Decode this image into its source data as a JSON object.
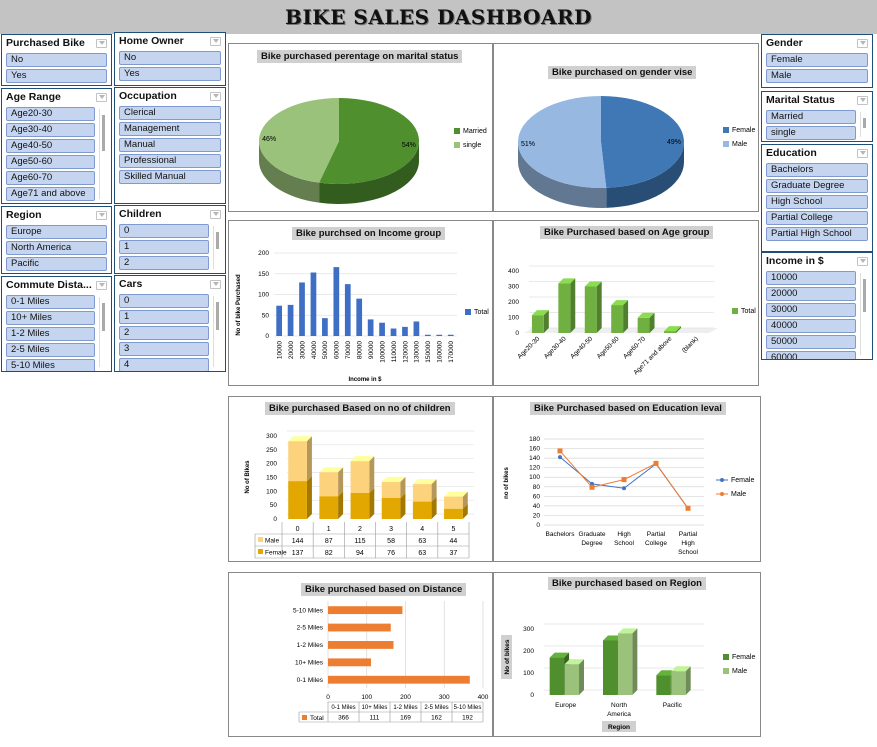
{
  "title": "BIKE SALES DASHBOARD",
  "slicers": {
    "purchased_bike": {
      "label": "Purchased Bike",
      "items": [
        "No",
        "Yes"
      ]
    },
    "home_owner": {
      "label": "Home Owner",
      "items": [
        "No",
        "Yes"
      ]
    },
    "age_range": {
      "label": "Age Range",
      "items": [
        "Age20-30",
        "Age30-40",
        "Age40-50",
        "Age50-60",
        "Age60-70",
        "Age71 and above"
      ]
    },
    "occupation": {
      "label": "Occupation",
      "items": [
        "Clerical",
        "Management",
        "Manual",
        "Professional",
        "Skilled Manual"
      ]
    },
    "region": {
      "label": "Region",
      "items": [
        "Europe",
        "North America",
        "Pacific"
      ]
    },
    "children": {
      "label": "Children",
      "items": [
        "0",
        "1",
        "2"
      ]
    },
    "commute": {
      "label": "Commute Dista...",
      "items": [
        "0-1 Miles",
        "10+ Miles",
        "1-2 Miles",
        "2-5 Miles",
        "5-10 Miles"
      ]
    },
    "cars": {
      "label": "Cars",
      "items": [
        "0",
        "1",
        "2",
        "3",
        "4"
      ]
    },
    "gender": {
      "label": "Gender",
      "items": [
        "Female",
        "Male"
      ]
    },
    "marital": {
      "label": "Marital Status",
      "items": [
        "Married",
        "single"
      ]
    },
    "education": {
      "label": "Education",
      "items": [
        "Bachelors",
        "Graduate Degree",
        "High School",
        "Partial College",
        "Partial High School"
      ]
    },
    "income": {
      "label": "Income in $",
      "items": [
        "10000",
        "20000",
        "30000",
        "40000",
        "50000",
        "60000"
      ]
    }
  },
  "chart_data": [
    {
      "id": "marital",
      "type": "pie",
      "title": "Bike purchased perentage on marital status",
      "categories": [
        "Married",
        "single"
      ],
      "values": [
        54,
        46
      ],
      "labels": [
        "54%",
        "46%"
      ],
      "colors": [
        "#4f8f2e",
        "#9ac27a"
      ]
    },
    {
      "id": "gender",
      "type": "pie",
      "title": "Bike purchased on gender vise",
      "categories": [
        "Female",
        "Male"
      ],
      "values": [
        49,
        51
      ],
      "labels": [
        "49%",
        "51%"
      ],
      "colors": [
        "#3f78b5",
        "#97b8e0"
      ]
    },
    {
      "id": "income",
      "type": "bar",
      "title": "Bike purchsed on Income group",
      "xlabel": "Income in $",
      "ylabel": "No of bike Purchased",
      "categories": [
        "10000",
        "20000",
        "30000",
        "40000",
        "50000",
        "60000",
        "70000",
        "80000",
        "90000",
        "100000",
        "110000",
        "120000",
        "130000",
        "150000",
        "160000",
        "170000"
      ],
      "series": [
        {
          "name": "Total",
          "values": [
            73,
            75,
            129,
            153,
            43,
            166,
            125,
            90,
            40,
            32,
            18,
            22,
            35,
            3,
            3,
            3
          ]
        }
      ],
      "ylim": [
        0,
        200
      ],
      "yticks": [
        0,
        50,
        100,
        150,
        200
      ],
      "color": "#3f6fc4"
    },
    {
      "id": "age",
      "type": "bar",
      "title": "Bike Purchased based on Age group",
      "categories": [
        "Age20-30",
        "Age30-40",
        "Age40-50",
        "Age50-60",
        "Age60-70",
        "Age71 and above",
        "(blank)"
      ],
      "series": [
        {
          "name": "Total",
          "values": [
            115,
            320,
            300,
            180,
            98,
            12,
            0
          ]
        }
      ],
      "ylim": [
        0,
        400
      ],
      "yticks": [
        0,
        100,
        200,
        300,
        400
      ],
      "color": "#6fb040"
    },
    {
      "id": "children",
      "type": "bar",
      "title": "Bike purchased Based on no of children",
      "ylabel": "No of Bikes",
      "categories": [
        "0",
        "1",
        "2",
        "3",
        "4",
        "5"
      ],
      "series": [
        {
          "name": "Male",
          "values": [
            144,
            87,
            115,
            58,
            63,
            44
          ],
          "color": "#fcd27d"
        },
        {
          "name": "Female",
          "values": [
            137,
            82,
            94,
            76,
            63,
            37
          ],
          "color": "#e2a700"
        }
      ],
      "ylim": [
        0,
        300
      ],
      "yticks": [
        0,
        50,
        100,
        150,
        200,
        250,
        300
      ]
    },
    {
      "id": "education",
      "type": "line",
      "title": "Bike Purchased based on Education leval",
      "ylabel": "no of bikes",
      "categories": [
        "Bachelors",
        "Graduate Degree",
        "High School",
        "Partial College",
        "Partial High School"
      ],
      "series": [
        {
          "name": "Female",
          "values": [
            142,
            86,
            77,
            128,
            35
          ],
          "color": "#4472c4"
        },
        {
          "name": "Male",
          "values": [
            155,
            79,
            95,
            129,
            35
          ],
          "color": "#ed7d31"
        }
      ],
      "ylim": [
        0,
        180
      ],
      "yticks": [
        0,
        20,
        40,
        60,
        80,
        100,
        120,
        140,
        160,
        180
      ]
    },
    {
      "id": "distance",
      "type": "bar",
      "title": "Bike purchased based on Distance",
      "categories": [
        "5-10 Miles",
        "2-5 Miles",
        "1-2 Miles",
        "10+ Miles",
        "0-1 Miles"
      ],
      "series": [
        {
          "name": "Total",
          "values": [
            192,
            162,
            169,
            111,
            366
          ]
        }
      ],
      "table_headers": [
        "0-1 Miles",
        "10+ Miles",
        "1-2 Miles",
        "2-5 Miles",
        "5-10 Miles"
      ],
      "table_values": [
        366,
        111,
        169,
        162,
        192
      ],
      "xlim": [
        0,
        400
      ],
      "xticks": [
        0,
        100,
        200,
        300,
        400
      ],
      "color": "#ed7d31"
    },
    {
      "id": "region",
      "type": "bar",
      "title": "Bike purchased based on Region",
      "xlabel": "Region",
      "ylabel": "No of bikes",
      "categories": [
        "Europe",
        "North America",
        "Pacific"
      ],
      "series": [
        {
          "name": "Female",
          "values": [
            170,
            248,
            90
          ],
          "color": "#4f8f2e"
        },
        {
          "name": "Male",
          "values": [
            140,
            280,
            108
          ],
          "color": "#9ac27a"
        }
      ],
      "ylim": [
        0,
        300
      ],
      "yticks": [
        0,
        100,
        200,
        300
      ]
    }
  ]
}
